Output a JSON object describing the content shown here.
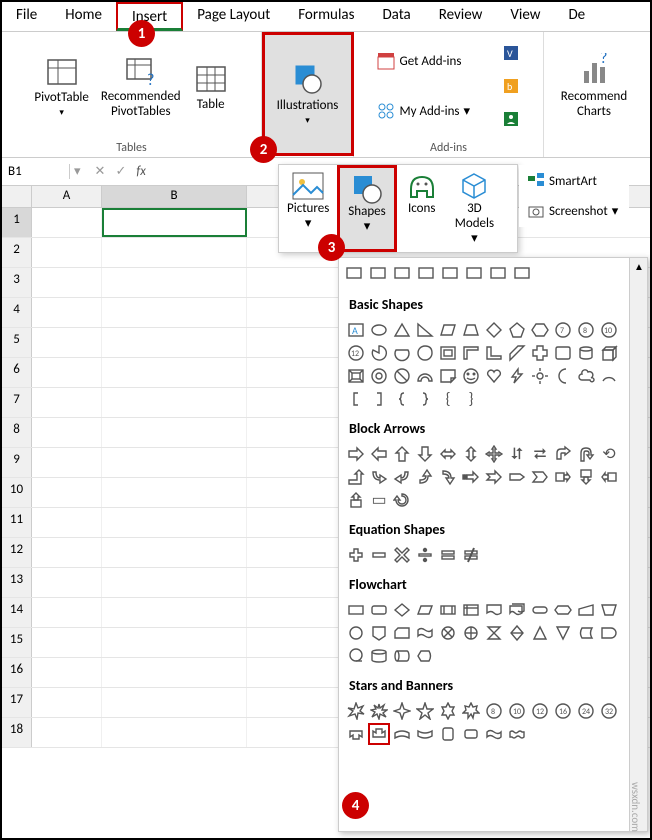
{
  "tabs": [
    "File",
    "Home",
    "Insert",
    "Page Layout",
    "Formulas",
    "Data",
    "Review",
    "View",
    "De"
  ],
  "activeTab": "Insert",
  "ribbon": {
    "tables": {
      "label": "Tables",
      "pivotTable": "PivotTable",
      "recommended": "Recommended\nPivotTables",
      "table": "Table"
    },
    "illustrations": {
      "label": "Illustrations",
      "btn": "Illustrations"
    },
    "addins": {
      "label": "Add-ins",
      "get": "Get Add-ins",
      "my": "My Add-ins"
    },
    "charts": {
      "btn": "Recommend\nCharts"
    }
  },
  "callouts": {
    "c1": "1",
    "c2": "2",
    "c3": "3",
    "c4": "4"
  },
  "nameBox": "B1",
  "columns": [
    "A",
    "B"
  ],
  "rows": [
    "1",
    "2",
    "3",
    "4",
    "5",
    "6",
    "7",
    "8",
    "9",
    "10",
    "11",
    "12",
    "13",
    "14",
    "15",
    "16",
    "17",
    "18"
  ],
  "illusDropdown": {
    "pictures": "Pictures",
    "shapes": "Shapes",
    "icons": "Icons",
    "models": "3D\nModels",
    "smartart": "SmartArt",
    "screenshot": "Screenshot"
  },
  "shapesGallery": {
    "cat1": "Basic Shapes",
    "cat2": "Block Arrows",
    "cat3": "Equation Shapes",
    "cat4": "Flowchart",
    "cat5": "Stars and Banners"
  },
  "watermark": "wsxdn.com"
}
